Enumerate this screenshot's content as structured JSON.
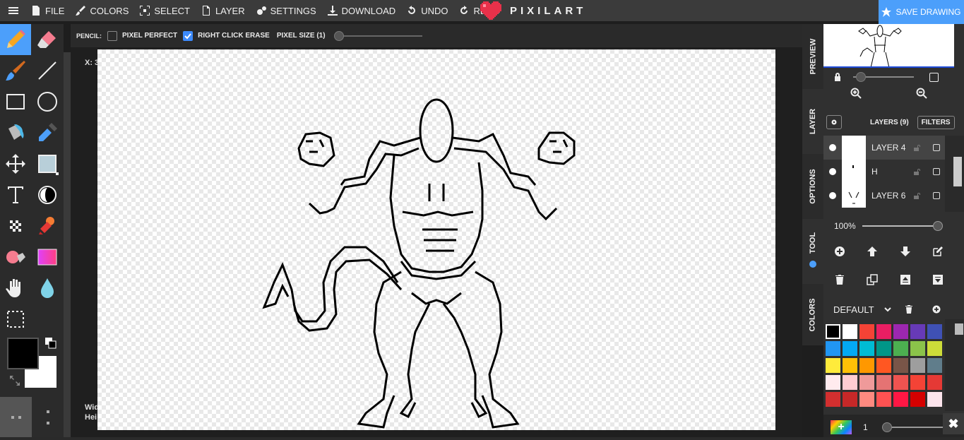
{
  "topbar": {
    "menu": [
      {
        "label": "FILE",
        "icon": "file-icon"
      },
      {
        "label": "COLORS",
        "icon": "brush-icon"
      },
      {
        "label": "SELECT",
        "icon": "select-icon"
      },
      {
        "label": "LAYER",
        "icon": "layer-icon"
      },
      {
        "label": "SETTINGS",
        "icon": "gear-icon"
      },
      {
        "label": "DOWNLOAD",
        "icon": "download-icon"
      },
      {
        "label": "UNDO",
        "icon": "undo-icon"
      },
      {
        "label": "REDO",
        "icon": "redo-icon"
      }
    ],
    "logo_text": "PIXILART",
    "save_label": "SAVE DRAWING",
    "accent": "#4c9ffb",
    "logo_color": "#e8314a"
  },
  "tools": [
    {
      "name": "pencil",
      "active": true
    },
    {
      "name": "eraser"
    },
    {
      "name": "brush"
    },
    {
      "name": "line"
    },
    {
      "name": "rectangle"
    },
    {
      "name": "ellipse"
    },
    {
      "name": "bucket"
    },
    {
      "name": "eyedropper"
    },
    {
      "name": "move"
    },
    {
      "name": "shape-fill"
    },
    {
      "name": "text"
    },
    {
      "name": "lighten-darken"
    },
    {
      "name": "dither"
    },
    {
      "name": "stamp"
    },
    {
      "name": "color-replace"
    },
    {
      "name": "gradient"
    },
    {
      "name": "hand"
    },
    {
      "name": "blur"
    },
    {
      "name": "selection"
    }
  ],
  "colors": {
    "primary": "#000000",
    "secondary": "#ffffff"
  },
  "tool_options": {
    "tool_name": "PENCIL:",
    "pixel_perfect": {
      "label": "PIXEL PERFECT",
      "checked": false
    },
    "right_click_erase": {
      "label": "RIGHT CLICK ERASE",
      "checked": true
    },
    "pixel_size_label": "PIXEL SIZE (1)"
  },
  "workspace": {
    "coords": "X: 3",
    "dims_width": "Wid",
    "dims_height": "Hei"
  },
  "side_tabs": [
    "PREVIEW",
    "LAYER",
    "OPTIONS",
    "TOOL",
    "COLORS"
  ],
  "layers_panel": {
    "title": "LAYERS (9)",
    "filters_label": "FILTERS",
    "layers": [
      {
        "name": "LAYER 4",
        "selected": true
      },
      {
        "name": "H"
      },
      {
        "name": "LAYER 6"
      }
    ],
    "opacity_label": "100%",
    "opacity": 1.0
  },
  "palette": {
    "name": "DEFAULT",
    "swatches": [
      "#000000",
      "#ffffff",
      "#f44336",
      "#e91e63",
      "#9c27b0",
      "#673ab7",
      "#3f51b5",
      "#2196f3",
      "#03a9f4",
      "#00bcd4",
      "#009688",
      "#4caf50",
      "#8bc34a",
      "#cddc39",
      "#ffeb3b",
      "#ffc107",
      "#ff9800",
      "#ff5722",
      "#795548",
      "#9e9e9e",
      "#607d8b",
      "#ffebee",
      "#ffcdd2",
      "#ef9a9a",
      "#e57373",
      "#ef5350",
      "#f44336",
      "#e53935",
      "#d32f2f",
      "#c62828",
      "#ff8a80",
      "#ff5252",
      "#ff1744",
      "#d50000",
      "#fce4ec"
    ],
    "brush_size": "1"
  }
}
